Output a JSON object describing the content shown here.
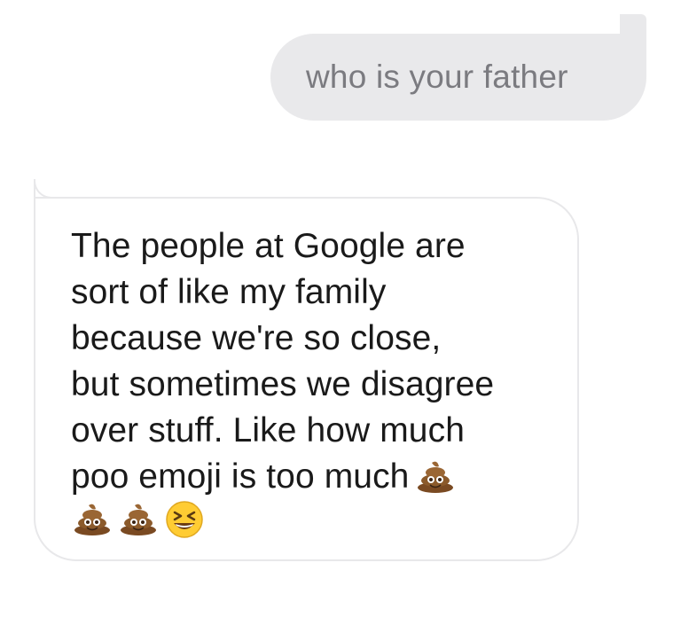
{
  "conversation": {
    "outgoing": {
      "text": "who is your father"
    },
    "incoming": {
      "lines": [
        "The people at Google are",
        "sort of like my family",
        "because we're so close,",
        "but sometimes we disagree",
        "over stuff. Like how much",
        "poo emoji is too much"
      ],
      "emojis": [
        "pile-of-poo",
        "pile-of-poo",
        "pile-of-poo",
        "grinning-squinting-face"
      ]
    }
  },
  "colors": {
    "outgoing_bubble": "#e9e9eb",
    "outgoing_text": "#7b7b80",
    "incoming_border": "#e8e8ea",
    "incoming_text": "#1a1a1a",
    "poo": "#8b5a2b",
    "laugh_face": "#ffcc33"
  }
}
